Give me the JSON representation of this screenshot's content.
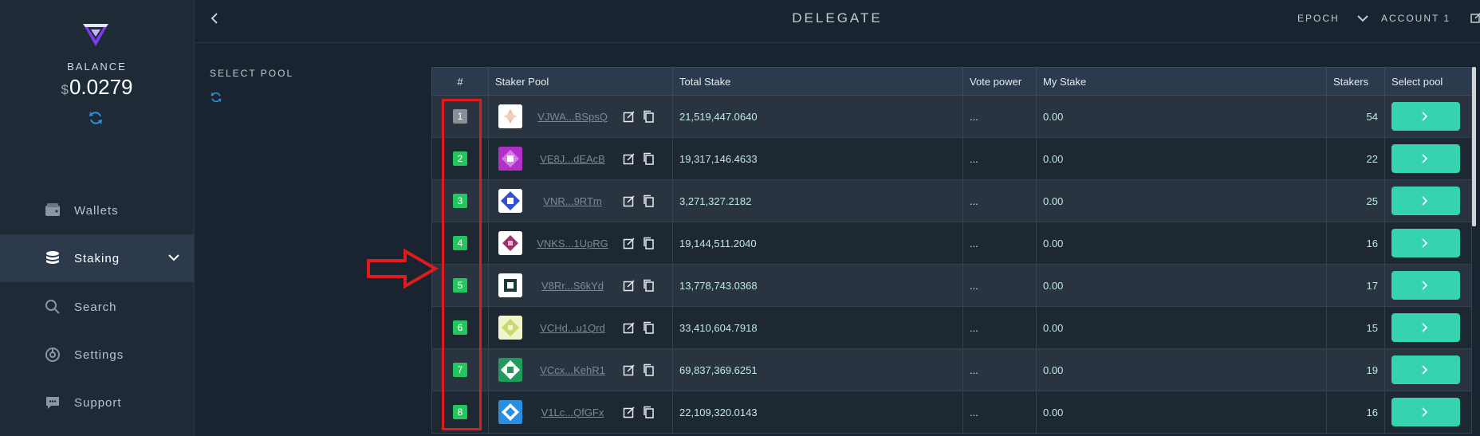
{
  "sidebar": {
    "balance_label": "BALANCE",
    "balance_currency": "$",
    "balance_value": "0.0279",
    "nav": [
      {
        "label": "Wallets",
        "icon": "wallet-icon"
      },
      {
        "label": "Staking",
        "icon": "database-icon",
        "active": true
      },
      {
        "label": "Search",
        "icon": "search-icon"
      },
      {
        "label": "Settings",
        "icon": "settings-icon"
      },
      {
        "label": "Support",
        "icon": "chat-icon"
      }
    ]
  },
  "header": {
    "title": "DELEGATE",
    "epoch_label": "EPOCH",
    "account_label": "ACCOUNT 1"
  },
  "content": {
    "select_pool_label": "SELECT POOL"
  },
  "table": {
    "columns": [
      "#",
      "Staker Pool",
      "Total Stake",
      "Vote power",
      "My Stake",
      "Stakers",
      "Select pool"
    ],
    "rows": [
      {
        "index": "1",
        "pool": "VJWA...BSpsQ",
        "total_stake": "21,519,447.0640",
        "vote_power": "...",
        "my_stake": "0.00",
        "stakers": "54"
      },
      {
        "index": "2",
        "pool": "VE8J...dEAcB",
        "total_stake": "19,317,146.4633",
        "vote_power": "...",
        "my_stake": "0.00",
        "stakers": "22"
      },
      {
        "index": "3",
        "pool": "VNR...9RTm",
        "total_stake": "3,271,327.2182",
        "vote_power": "...",
        "my_stake": "0.00",
        "stakers": "25"
      },
      {
        "index": "4",
        "pool": "VNKS...1UpRG",
        "total_stake": "19,144,511.2040",
        "vote_power": "...",
        "my_stake": "0.00",
        "stakers": "16"
      },
      {
        "index": "5",
        "pool": "V8Rr...S6kYd",
        "total_stake": "13,778,743.0368",
        "vote_power": "...",
        "my_stake": "0.00",
        "stakers": "17"
      },
      {
        "index": "6",
        "pool": "VCHd...u1Qrd",
        "total_stake": "33,410,604.7918",
        "vote_power": "...",
        "my_stake": "0.00",
        "stakers": "15"
      },
      {
        "index": "7",
        "pool": "VCcx...KehR1",
        "total_stake": "69,837,369.6251",
        "vote_power": "...",
        "my_stake": "0.00",
        "stakers": "19"
      },
      {
        "index": "8",
        "pool": "V1Lc...QfGFx",
        "total_stake": "22,109,320.0143",
        "vote_power": "...",
        "my_stake": "0.00",
        "stakers": "16"
      }
    ]
  },
  "colors": {
    "accent": "#36d3b0",
    "badge_green": "#22c55e",
    "badge_gray": "#8a8f95",
    "annotation_red": "#e01b1b"
  }
}
